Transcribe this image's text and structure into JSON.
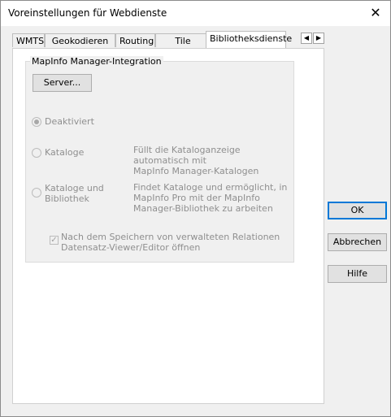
{
  "window": {
    "title": "Voreinstellungen für Webdienste",
    "close_glyph": "✕"
  },
  "tabs": [
    {
      "label": "WMTS"
    },
    {
      "label": "Geokodieren"
    },
    {
      "label": "Routing"
    },
    {
      "label": "Tile Server"
    },
    {
      "label": "Bibliotheksdienste",
      "active": true
    }
  ],
  "tab_scroll": {
    "left_glyph": "◀",
    "right_glyph": "▶"
  },
  "group": {
    "title": "MapInfo Manager-Integration",
    "server_button": "Server...",
    "options": [
      {
        "label": "Deaktiviert",
        "selected": true,
        "description": ""
      },
      {
        "label": "Kataloge",
        "selected": false,
        "description_lines": [
          "Füllt die Kataloganzeige automatisch mit",
          "MapInfo Manager-Katalogen"
        ]
      },
      {
        "label_lines": [
          "Kataloge und",
          "Bibliothek"
        ],
        "selected": false,
        "description_lines": [
          "Findet Kataloge und ermöglicht, in",
          "MapInfo Pro mit der MapInfo",
          "Manager-Bibliothek zu arbeiten"
        ]
      }
    ],
    "checkbox": {
      "checked": true,
      "glyph": "✓",
      "label_lines": [
        "Nach dem Speichern von verwalteten Relationen",
        "Datensatz-Viewer/Editor öffnen"
      ]
    }
  },
  "buttons": {
    "ok": "OK",
    "cancel": "Abbrechen",
    "help": "Hilfe"
  }
}
